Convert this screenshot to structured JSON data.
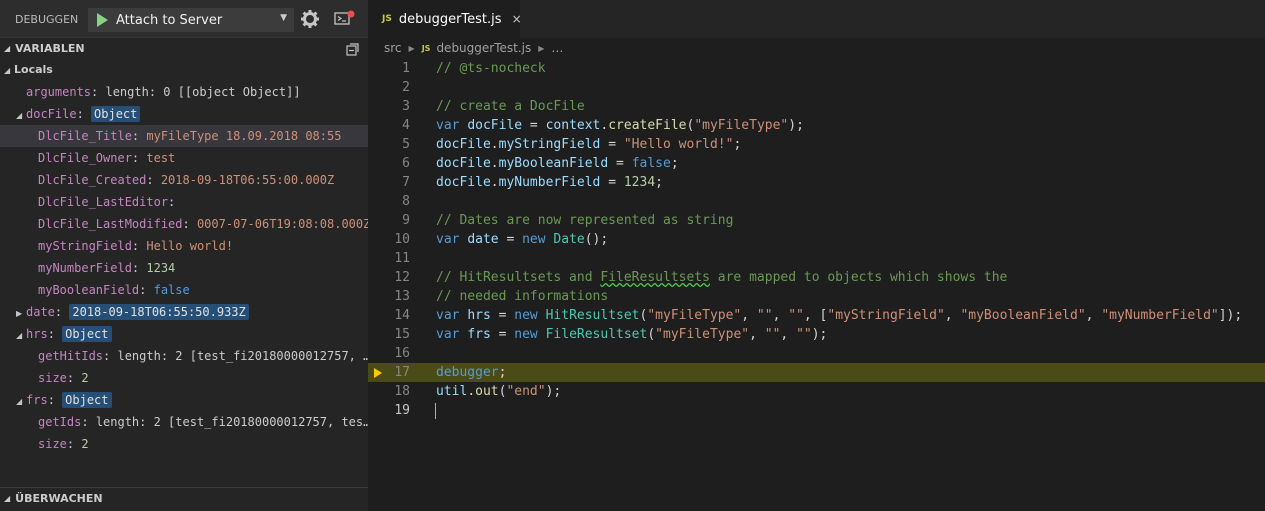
{
  "debug_toolbar": {
    "title": "DEBUGGEN",
    "config": "Attach to Server"
  },
  "variables": {
    "header": "VARIABLEN",
    "rows": [
      {
        "kind": "scope",
        "twisty": "◢",
        "label": "Locals"
      },
      {
        "indent": 1,
        "name": "arguments",
        "value": "length: 0 [[object Object]]",
        "type": "obj"
      },
      {
        "indent": 1,
        "twisty": "◢",
        "name": "docFile",
        "tag": "Object"
      },
      {
        "indent": 2,
        "name": "DlcFile_Title",
        "value": "myFileType 18.09.2018  08:55",
        "type": "str",
        "selected": true
      },
      {
        "indent": 2,
        "name": "DlcFile_Owner",
        "value": "test",
        "type": "str"
      },
      {
        "indent": 2,
        "name": "DlcFile_Created",
        "value": "2018-09-18T06:55:00.000Z",
        "type": "str"
      },
      {
        "indent": 2,
        "name": "DlcFile_LastEditor",
        "value": "",
        "type": "str"
      },
      {
        "indent": 2,
        "name": "DlcFile_LastModified",
        "value": "0007-07-06T19:08:08.000Z",
        "type": "str"
      },
      {
        "indent": 2,
        "name": "myStringField",
        "value": "Hello world!",
        "type": "str"
      },
      {
        "indent": 2,
        "name": "myNumberField",
        "value": "1234",
        "type": "num"
      },
      {
        "indent": 2,
        "name": "myBooleanField",
        "value": "false",
        "type": "bool"
      },
      {
        "indent": 1,
        "twisty": "▶",
        "name": "date",
        "tag": "2018-09-18T06:55:50.933Z"
      },
      {
        "indent": 1,
        "twisty": "◢",
        "name": "hrs",
        "tag": "Object"
      },
      {
        "indent": 2,
        "name": "getHitIds",
        "value": "length: 2 [test_fi20180000012757, …",
        "type": "obj"
      },
      {
        "indent": 2,
        "name": "size",
        "value": "2",
        "type": "num"
      },
      {
        "indent": 1,
        "twisty": "◢",
        "name": "frs",
        "tag": "Object"
      },
      {
        "indent": 2,
        "name": "getIds",
        "value": "length: 2 [test_fi20180000012757, tes…",
        "type": "obj"
      },
      {
        "indent": 2,
        "name": "size",
        "value": "2",
        "type": "num"
      }
    ]
  },
  "watch": {
    "header": "ÜBERWACHEN"
  },
  "editor": {
    "tab": {
      "badge": "JS",
      "label": "debuggerTest.js",
      "close": "×"
    },
    "breadcrumb": {
      "folder": "src",
      "badge": "JS",
      "file": "debuggerTest.js",
      "tail": "…"
    },
    "current_line": 17,
    "active_line": 19,
    "lines": [
      [
        [
          "c-com",
          "// @ts-nocheck"
        ]
      ],
      [],
      [
        [
          "c-com",
          "// create a DocFile"
        ]
      ],
      [
        [
          "c-kw",
          "var"
        ],
        [
          "c-pun",
          " "
        ],
        [
          "c-var",
          "docFile"
        ],
        [
          "c-pun",
          " = "
        ],
        [
          "c-var",
          "context"
        ],
        [
          "c-pun",
          "."
        ],
        [
          "c-fn",
          "createFile"
        ],
        [
          "c-pun",
          "("
        ],
        [
          "c-str",
          "\"myFileType\""
        ],
        [
          "c-pun",
          ");"
        ]
      ],
      [
        [
          "c-var",
          "docFile"
        ],
        [
          "c-pun",
          "."
        ],
        [
          "c-var",
          "myStringField"
        ],
        [
          "c-pun",
          " = "
        ],
        [
          "c-str",
          "\"Hello world!\""
        ],
        [
          "c-pun",
          ";"
        ]
      ],
      [
        [
          "c-var",
          "docFile"
        ],
        [
          "c-pun",
          "."
        ],
        [
          "c-var",
          "myBooleanField"
        ],
        [
          "c-pun",
          " = "
        ],
        [
          "c-kw",
          "false"
        ],
        [
          "c-pun",
          ";"
        ]
      ],
      [
        [
          "c-var",
          "docFile"
        ],
        [
          "c-pun",
          "."
        ],
        [
          "c-var",
          "myNumberField"
        ],
        [
          "c-pun",
          " = "
        ],
        [
          "c-num",
          "1234"
        ],
        [
          "c-pun",
          ";"
        ]
      ],
      [],
      [
        [
          "c-com",
          "// Dates are now represented as string"
        ]
      ],
      [
        [
          "c-kw",
          "var"
        ],
        [
          "c-pun",
          " "
        ],
        [
          "c-var",
          "date"
        ],
        [
          "c-pun",
          " = "
        ],
        [
          "c-kw",
          "new"
        ],
        [
          "c-pun",
          " "
        ],
        [
          "c-cls",
          "Date"
        ],
        [
          "c-pun",
          "();"
        ]
      ],
      [],
      [
        [
          "c-com",
          "// HitResultsets and "
        ],
        [
          "c-com squig",
          "FileResultsets"
        ],
        [
          "c-com",
          " are mapped to objects which shows the"
        ]
      ],
      [
        [
          "c-com",
          "// needed informations"
        ]
      ],
      [
        [
          "c-kw",
          "var"
        ],
        [
          "c-pun",
          " "
        ],
        [
          "c-var",
          "hrs"
        ],
        [
          "c-pun",
          " = "
        ],
        [
          "c-kw",
          "new"
        ],
        [
          "c-pun",
          " "
        ],
        [
          "c-cls",
          "HitResultset"
        ],
        [
          "c-pun",
          "("
        ],
        [
          "c-str",
          "\"myFileType\""
        ],
        [
          "c-pun",
          ", "
        ],
        [
          "c-str",
          "\"\""
        ],
        [
          "c-pun",
          ", "
        ],
        [
          "c-str",
          "\"\""
        ],
        [
          "c-pun",
          ", ["
        ],
        [
          "c-str",
          "\"myStringField\""
        ],
        [
          "c-pun",
          ", "
        ],
        [
          "c-str",
          "\"myBooleanField\""
        ],
        [
          "c-pun",
          ", "
        ],
        [
          "c-str",
          "\"myNumberField\""
        ],
        [
          "c-pun",
          "]);"
        ]
      ],
      [
        [
          "c-kw",
          "var"
        ],
        [
          "c-pun",
          " "
        ],
        [
          "c-var",
          "frs"
        ],
        [
          "c-pun",
          " = "
        ],
        [
          "c-kw",
          "new"
        ],
        [
          "c-pun",
          " "
        ],
        [
          "c-cls",
          "FileResultset"
        ],
        [
          "c-pun",
          "("
        ],
        [
          "c-str",
          "\"myFileType\""
        ],
        [
          "c-pun",
          ", "
        ],
        [
          "c-str",
          "\"\""
        ],
        [
          "c-pun",
          ", "
        ],
        [
          "c-str",
          "\"\""
        ],
        [
          "c-pun",
          ");"
        ]
      ],
      [],
      [
        [
          "c-kw",
          "debugger"
        ],
        [
          "c-pun",
          ";"
        ]
      ],
      [
        [
          "c-var",
          "util"
        ],
        [
          "c-pun",
          "."
        ],
        [
          "c-fn",
          "out"
        ],
        [
          "c-pun",
          "("
        ],
        [
          "c-str",
          "\"end\""
        ],
        [
          "c-pun",
          ");"
        ]
      ],
      []
    ]
  }
}
